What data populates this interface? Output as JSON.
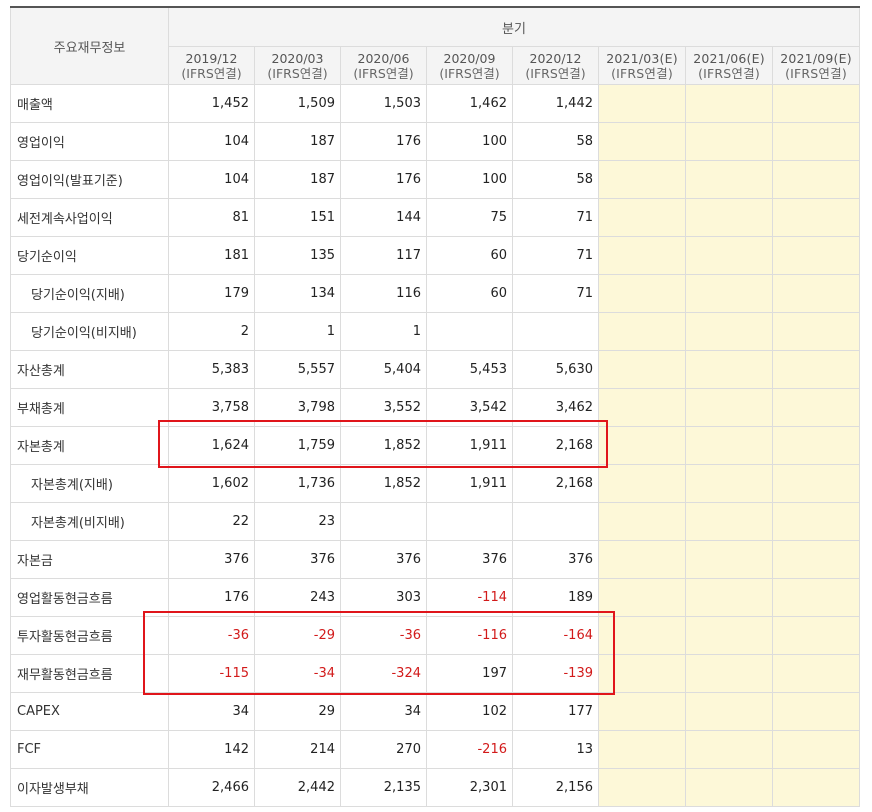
{
  "header": {
    "corner_label": "주요재무정보",
    "period_label": "분기",
    "columns": [
      {
        "date": "2019/12",
        "type": "(IFRS연결)"
      },
      {
        "date": "2020/03",
        "type": "(IFRS연결)"
      },
      {
        "date": "2020/06",
        "type": "(IFRS연결)"
      },
      {
        "date": "2020/09",
        "type": "(IFRS연결)"
      },
      {
        "date": "2020/12",
        "type": "(IFRS연결)"
      },
      {
        "date": "2021/03(E)",
        "type": "(IFRS연결)"
      },
      {
        "date": "2021/06(E)",
        "type": "(IFRS연결)"
      },
      {
        "date": "2021/09(E)",
        "type": "(IFRS연결)"
      }
    ]
  },
  "rows": [
    {
      "label": "매출액",
      "values": [
        "1,452",
        "1,509",
        "1,503",
        "1,462",
        "1,442"
      ]
    },
    {
      "label": "영업이익",
      "values": [
        "104",
        "187",
        "176",
        "100",
        "58"
      ]
    },
    {
      "label": "영업이익(발표기준)",
      "values": [
        "104",
        "187",
        "176",
        "100",
        "58"
      ]
    },
    {
      "label": "세전계속사업이익",
      "values": [
        "81",
        "151",
        "144",
        "75",
        "71"
      ]
    },
    {
      "label": "당기순이익",
      "values": [
        "181",
        "135",
        "117",
        "60",
        "71"
      ]
    },
    {
      "label": "당기순이익(지배)",
      "values": [
        "179",
        "134",
        "116",
        "60",
        "71"
      ]
    },
    {
      "label": "당기순이익(비지배)",
      "values": [
        "2",
        "1",
        "1",
        "",
        ""
      ]
    },
    {
      "label": "자산총계",
      "values": [
        "5,383",
        "5,557",
        "5,404",
        "5,453",
        "5,630"
      ]
    },
    {
      "label": "부채총계",
      "values": [
        "3,758",
        "3,798",
        "3,552",
        "3,542",
        "3,462"
      ]
    },
    {
      "label": "자본총계",
      "values": [
        "1,624",
        "1,759",
        "1,852",
        "1,911",
        "2,168"
      ]
    },
    {
      "label": "자본총계(지배)",
      "values": [
        "1,602",
        "1,736",
        "1,852",
        "1,911",
        "2,168"
      ]
    },
    {
      "label": "자본총계(비지배)",
      "values": [
        "22",
        "23",
        "",
        "",
        ""
      ]
    },
    {
      "label": "자본금",
      "values": [
        "376",
        "376",
        "376",
        "376",
        "376"
      ]
    },
    {
      "label": "영업활동현금흐름",
      "values": [
        "176",
        "243",
        "303",
        "-114",
        "189"
      ]
    },
    {
      "label": "투자활동현금흐름",
      "values": [
        "-36",
        "-29",
        "-36",
        "-116",
        "-164"
      ]
    },
    {
      "label": "재무활동현금흐름",
      "values": [
        "-115",
        "-34",
        "-324",
        "197",
        "-139"
      ]
    },
    {
      "label": "CAPEX",
      "values": [
        "34",
        "29",
        "34",
        "102",
        "177"
      ]
    },
    {
      "label": "FCF",
      "values": [
        "142",
        "214",
        "270",
        "-216",
        "13"
      ]
    },
    {
      "label": "이자발생부채",
      "values": [
        "2,466",
        "2,442",
        "2,135",
        "2,301",
        "2,156"
      ]
    }
  ],
  "colors": {
    "negative": "#d21a1a",
    "estimate_bg": "#fdf8d8",
    "highlight_box": "#e0151b"
  }
}
